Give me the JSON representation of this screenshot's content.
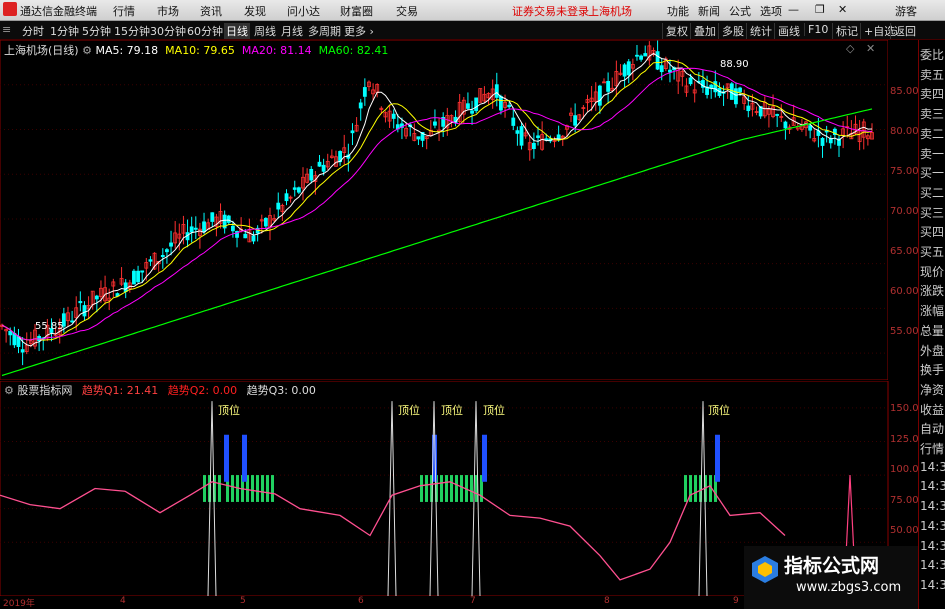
{
  "app": {
    "title": "通达信金融终端",
    "menus": [
      "行情",
      "市场",
      "资讯",
      "发现",
      "问小达",
      "财富圈",
      "交易"
    ],
    "notice": "证券交易未登录",
    "broker": "上海机场",
    "right_menus": [
      "功能",
      "新闻",
      "公式",
      "选项"
    ],
    "guest": "游客"
  },
  "toolbar": {
    "periods": [
      "分时",
      "1分钟",
      "5分钟",
      "15分钟",
      "30分钟",
      "60分钟",
      "日线",
      "周线",
      "月线",
      "多周期",
      "更多 ›"
    ],
    "active_period": "日线",
    "buttons": [
      "复权",
      "叠加",
      "多股",
      "统计",
      "画线",
      "F10",
      "标记",
      "+自选",
      "返回"
    ]
  },
  "main": {
    "title": "上海机场(日线)",
    "ma": [
      {
        "label": "MA5: 79.18",
        "color": "#ffffff"
      },
      {
        "label": "MA10: 79.65",
        "color": "#ffff00"
      },
      {
        "label": "MA20: 81.14",
        "color": "#ff00ff"
      },
      {
        "label": "MA60: 82.41",
        "color": "#00ff00"
      }
    ],
    "high_label": "88.90",
    "low_label": "55.85",
    "y_ticks": [
      "85.00",
      "80.00",
      "75.00",
      "70.00",
      "65.00",
      "60.00",
      "55.00"
    ]
  },
  "indicator": {
    "title": "股票指标网",
    "q1": "趋势Q1: 21.41",
    "q2": "趋势Q2: 0.00",
    "q3": "趋势Q3: 0.00",
    "peak_label": "顶位",
    "y_ticks": [
      "150.00",
      "125.00",
      "100.00",
      "75.00",
      "50.00"
    ]
  },
  "xaxis": {
    "labels": [
      "2019年",
      "4",
      "5",
      "6",
      "7",
      "8",
      "9"
    ]
  },
  "sidebar": {
    "items": [
      "委比",
      "卖五",
      "卖四",
      "卖三",
      "卖二",
      "卖一",
      "买一",
      "买二",
      "买三",
      "买四",
      "买五",
      "现价",
      "涨跌",
      "涨幅",
      "总量",
      "外盘",
      "换手",
      "净资",
      "收益",
      "自动",
      "行情",
      "14:3",
      "14:3",
      "14:3",
      "14:3",
      "14:3",
      "14:3",
      "14:3"
    ]
  },
  "watermark": {
    "title": "指标公式网",
    "url": "www.zbgs3.com"
  },
  "colors": {
    "up": "#ff3030",
    "down": "#00ffff",
    "ma5": "#ffffff",
    "ma10": "#ffff00",
    "ma20": "#ff00ff",
    "ma60": "#00ff00",
    "pink": "#ff5090",
    "border": "#8a0000"
  },
  "chart_data": {
    "type": "line",
    "title": "上海机场(日线)",
    "x": [
      "2019-03",
      "2019-04",
      "2019-05",
      "2019-06",
      "2019-07",
      "2019-08",
      "2019-09"
    ],
    "series": [
      {
        "name": "MA5",
        "values": [
          57,
          62,
          70,
          69,
          80,
          83,
          79.18
        ]
      },
      {
        "name": "MA10",
        "values": [
          56.5,
          61,
          69,
          70,
          79,
          83,
          79.65
        ]
      },
      {
        "name": "MA20",
        "values": [
          55.5,
          59,
          66,
          69.5,
          78,
          81,
          81.14
        ]
      },
      {
        "name": "MA60",
        "values": [
          53,
          56,
          62,
          66,
          72,
          78,
          82.41
        ]
      }
    ],
    "ylim": [
      52,
      90
    ],
    "annotations": [
      "88.90",
      "55.85"
    ]
  }
}
